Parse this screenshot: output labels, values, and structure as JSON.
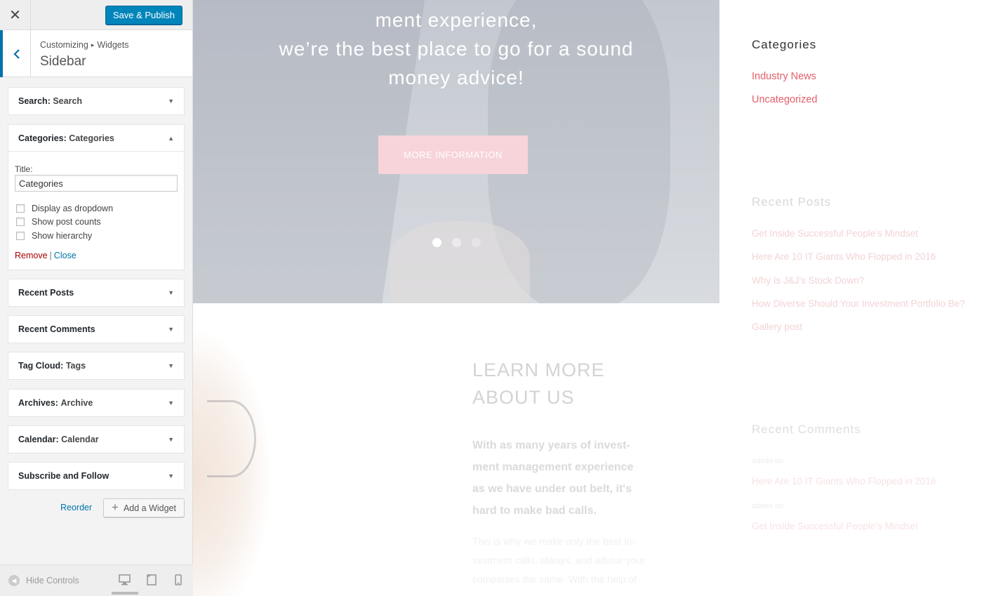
{
  "customizer": {
    "close_label": "✕",
    "save_label": "Save & Publish",
    "breadcrumb": {
      "root": "Customizing",
      "arrow": "▸",
      "parent": "Widgets"
    },
    "section_title": "Sidebar",
    "widgets": [
      {
        "type": "Search:",
        "title": "Search"
      },
      {
        "type": "Categories:",
        "title": "Categories"
      },
      {
        "type": "Recent Posts",
        "title": ""
      },
      {
        "type": "Recent Comments",
        "title": ""
      },
      {
        "type": "Tag Cloud:",
        "title": "Tags"
      },
      {
        "type": "Archives:",
        "title": "Archive"
      },
      {
        "type": "Calendar:",
        "title": "Calendar"
      },
      {
        "type": "Subscribe and Follow",
        "title": ""
      }
    ],
    "categories_form": {
      "title_label": "Title:",
      "title_value": "Categories",
      "options": [
        "Display as dropdown",
        "Show post counts",
        "Show hierarchy"
      ],
      "remove_label": "Remove",
      "separator": "|",
      "close_label": "Close"
    },
    "reorder_label": "Reorder",
    "add_widget_label": "Add a Widget",
    "hide_controls_label": "Hide Controls"
  },
  "preview": {
    "hero_lines": [
      "ment experience,",
      "we’re the best place to go for a sound",
      "money advice!"
    ],
    "hero_button": "MORE INFORMATION",
    "about_title_lines": [
      "LEARN MORE",
      "ABOUT US"
    ],
    "about_lead_lines": [
      "With as many years of invest-",
      "ment management experience",
      "as we have under out belt, it's",
      "hard to make bad calls."
    ],
    "about_body_lines": [
      "This is why we make only the best in-",
      "vestment calls, always, and advise your",
      "companies the same. With the help of"
    ],
    "sidebar": {
      "categories_title": "Categories",
      "categories": [
        "Industry News",
        "Uncategorized"
      ],
      "recent_posts_title": "Recent Posts",
      "recent_posts": [
        "Get Inside Successful People’s Mindset",
        "Here Are 10 IT Giants Who Flopped in 2016",
        "Why Is J&J’s Stock Down?",
        "How Diverse Should Your Investment Portfolio Be?",
        "Gallery post"
      ],
      "recent_comments_title": "Recent Comments",
      "recent_comments": [
        {
          "meta": "admin  on",
          "post": "Here Are 10 IT Giants Who Flopped in 2016"
        },
        {
          "meta": "admin  on",
          "post": "Get Inside Successful People’s Mindset"
        }
      ]
    }
  }
}
